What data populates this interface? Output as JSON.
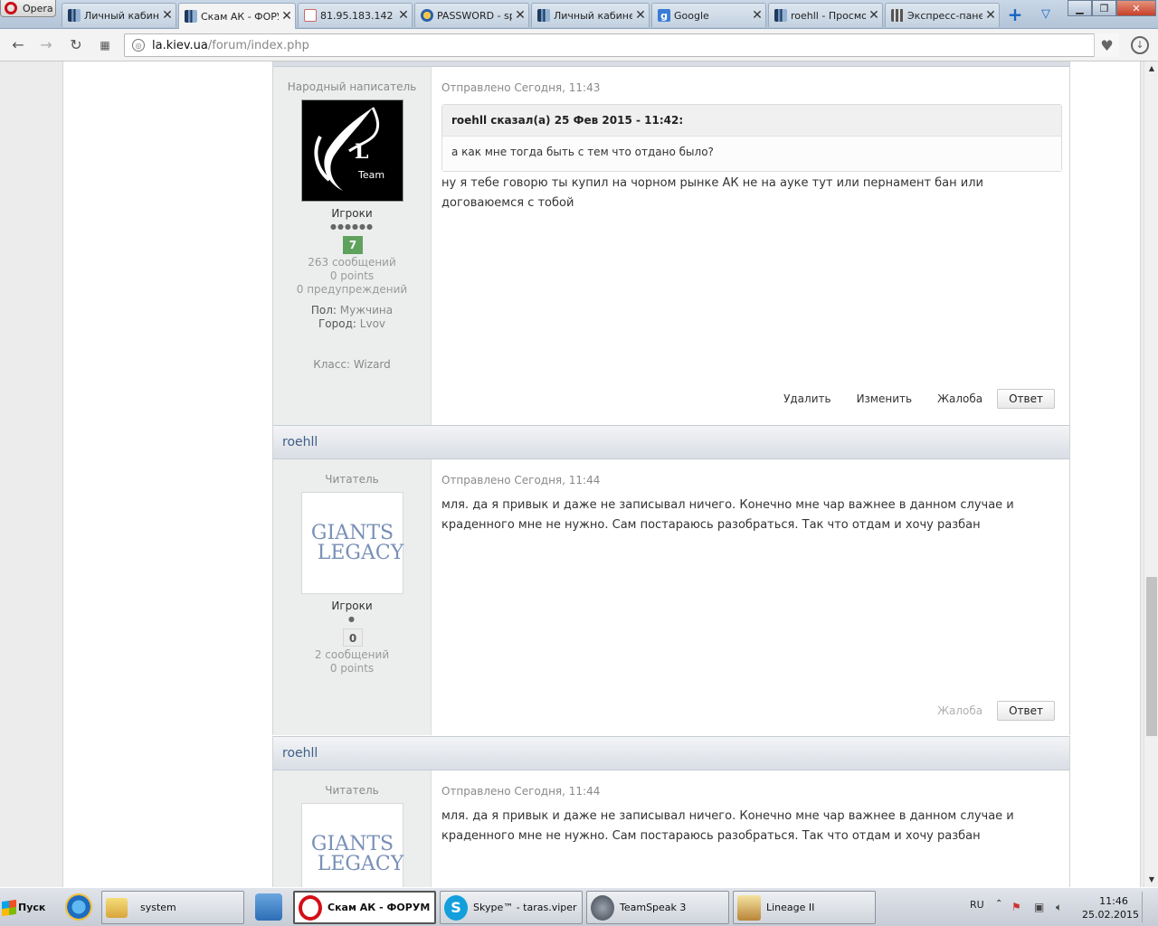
{
  "browser": {
    "menu_label": "Opera",
    "tabs": [
      {
        "label": "Личный кабин",
        "icon": "la-favicon"
      },
      {
        "label": "Скам АК - ФОРУ",
        "icon": "la-favicon",
        "active": true
      },
      {
        "label": "81.95.183.142",
        "icon": "ip-favicon"
      },
      {
        "label": "PASSWORD - sp",
        "icon": "password-favicon"
      },
      {
        "label": "Личный кабинет",
        "icon": "la-favicon"
      },
      {
        "label": "Google",
        "icon": "google-favicon"
      },
      {
        "label": "roehll - Просмот",
        "icon": "la-favicon"
      },
      {
        "label": "Экспресс-пане",
        "icon": "express-favicon"
      }
    ],
    "new_tab_glyph": "+",
    "tab_menu_glyph": "▽",
    "url_host": "la.kiev.ua",
    "url_path": "/forum/index.php"
  },
  "posts": [
    {
      "user_title": "Народный написатель",
      "avatar": "sl-team",
      "avatar_text": "L",
      "avatar_sub": "Team",
      "group": "Игроки",
      "pips": "●●●●●●",
      "reputation": "7",
      "messages": "263 сообщений",
      "points": "0 points",
      "warnings": "0 предупреждений",
      "gender_label": "Пол:",
      "gender": "Мужчина",
      "city_label": "Город:",
      "city": "Lvov",
      "class_label": "Класс:",
      "class_value": "Wizard",
      "posted": "Отправлено Сегодня, 11:43",
      "quote_head": "roehll сказал(а) 25 Фев 2015 - 11:42:",
      "quote_body": "а как мне тогда быть с тем что отдано было?",
      "body": "ну я тебе говорю ты купил на чорном рынке АК не на ауке тут или пернамент бан или договаюемся с тобой",
      "actions": {
        "delete": "Удалить",
        "edit": "Изменить",
        "report": "Жалоба",
        "reply": "Ответ"
      }
    },
    {
      "author": "roehll",
      "user_title": "Читатель",
      "avatar": "giants-legacy",
      "avatar_line1": "GIANTS",
      "avatar_line2": "LEGACY",
      "group": "Игроки",
      "pips": "●",
      "reputation": "0",
      "messages": "2 сообщений",
      "points": "0 points",
      "posted": "Отправлено Сегодня, 11:44",
      "body": "мля. да я привык и даже не записывал ничего. Конечно мне чар важнее в данном случае и краденного мне не нужно. Сам постараюсь разобраться. Так что отдам и хочу разбан",
      "actions": {
        "report": "Жалоба",
        "reply": "Ответ"
      }
    },
    {
      "author": "roehll",
      "user_title": "Читатель",
      "avatar": "giants-legacy",
      "avatar_line1": "GIANTS",
      "avatar_line2": "LEGACY",
      "posted": "Отправлено Сегодня, 11:44",
      "body": "мля. да я привык и даже не записывал ничего. Конечно мне чар важнее в данном случае и краденного мне не нужно. Сам постараюсь разобраться. Так что отдам и хочу разбан"
    }
  ],
  "taskbar": {
    "start_label": "Пуск",
    "items": [
      {
        "label": "system",
        "icon": "folder-icon"
      },
      {
        "label": "Скам АК - ФОРУМ ...",
        "icon": "opera-icon",
        "active": true
      },
      {
        "label": "Skype™ - taras.viper",
        "icon": "skype-icon"
      },
      {
        "label": "TeamSpeak 3",
        "icon": "teamspeak-icon"
      },
      {
        "label": "Lineage II",
        "icon": "lineage-icon"
      }
    ],
    "language": "RU",
    "time": "11:46",
    "date": "25.02.2015"
  }
}
